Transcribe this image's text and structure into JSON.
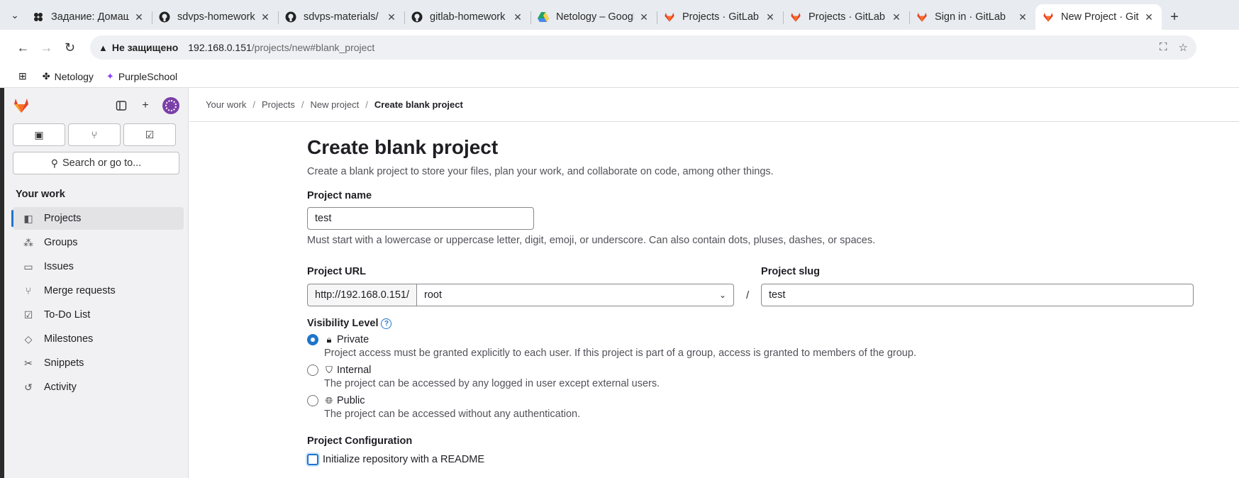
{
  "browser": {
    "tabs": [
      {
        "title": "Задание: Домашнее задание",
        "favicon": "netology-icon",
        "close": "✕",
        "active": false
      },
      {
        "title": "sdvps-homework",
        "favicon": "github-icon",
        "close": "✕",
        "active": false
      },
      {
        "title": "sdvps-materials/",
        "favicon": "github-icon",
        "close": "✕",
        "active": false
      },
      {
        "title": "gitlab-homework",
        "favicon": "github-icon",
        "close": "✕",
        "active": false
      },
      {
        "title": "Netology – Google",
        "favicon": "google-drive-icon",
        "close": "✕",
        "active": false
      },
      {
        "title": "Projects · GitLab",
        "favicon": "gitlab-icon",
        "close": "✕",
        "active": false
      },
      {
        "title": "Projects · GitLab",
        "favicon": "gitlab-icon",
        "close": "✕",
        "active": false
      },
      {
        "title": "Sign in · GitLab",
        "favicon": "gitlab-icon",
        "close": "✕",
        "active": false
      },
      {
        "title": "New Project · GitLab",
        "favicon": "gitlab-icon",
        "close": "✕",
        "active": true
      }
    ],
    "newtab": "+",
    "security": "Не защищено",
    "url_host": "192.168.0.151",
    "url_path": "/projects/new#blank_project",
    "bookmarks": [
      {
        "label": "Netology",
        "icon": "netology-icon"
      },
      {
        "label": "PurpleSchool",
        "icon": "purpleschool-icon"
      }
    ]
  },
  "sidebar": {
    "section": "Your work",
    "search_label": "Search or go to...",
    "items": [
      {
        "label": "Projects",
        "icon": "project-icon",
        "active": true
      },
      {
        "label": "Groups",
        "icon": "group-icon",
        "active": false
      },
      {
        "label": "Issues",
        "icon": "issues-icon",
        "active": false
      },
      {
        "label": "Merge requests",
        "icon": "merge-request-icon",
        "active": false
      },
      {
        "label": "To-Do List",
        "icon": "todo-icon",
        "active": false
      },
      {
        "label": "Milestones",
        "icon": "milestone-icon",
        "active": false
      },
      {
        "label": "Snippets",
        "icon": "snippet-icon",
        "active": false
      },
      {
        "label": "Activity",
        "icon": "history-icon",
        "active": false
      }
    ]
  },
  "breadcrumbs": [
    "Your work",
    "Projects",
    "New project",
    "Create blank project"
  ],
  "page": {
    "title": "Create blank project",
    "description": "Create a blank project to store your files, plan your work, and collaborate on code, among other things.",
    "project_name_label": "Project name",
    "project_name_value": "test",
    "project_name_help": "Must start with a lowercase or uppercase letter, digit, emoji, or underscore. Can also contain dots, pluses, dashes, or spaces.",
    "project_url_label": "Project URL",
    "url_prefix": "http://192.168.0.151/",
    "namespace": "root",
    "slash": "/",
    "project_slug_label": "Project slug",
    "project_slug_value": "test",
    "visibility_label": "Visibility Level",
    "visibility": [
      {
        "label": "Private",
        "icon": "lock-icon",
        "selected": true,
        "help": "Project access must be granted explicitly to each user. If this project is part of a group, access is granted to members of the group."
      },
      {
        "label": "Internal",
        "icon": "shield-icon",
        "selected": false,
        "help": "The project can be accessed by any logged in user except external users."
      },
      {
        "label": "Public",
        "icon": "globe-icon",
        "selected": false,
        "help": "The project can be accessed without any authentication."
      }
    ],
    "config_label": "Project Configuration",
    "readme_label": "Initialize repository with a README"
  },
  "colors": {
    "accent": "#1f75cb",
    "gitlab_orange": "#e24329",
    "sidebar_bg": "#f1f1f3"
  }
}
